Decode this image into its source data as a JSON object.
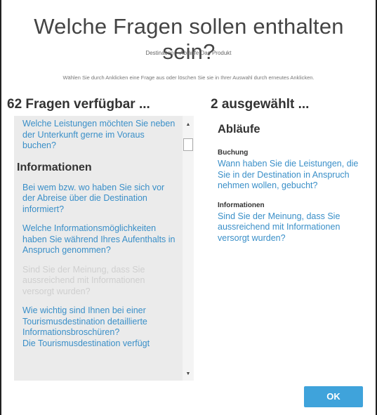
{
  "dialog": {
    "title": "Welche Fragen sollen enthalten sein?",
    "breadcrumb": "Destination > Abläufe Das Produkt",
    "instruction": "Wählen Sie durch Anklicken eine Frage aus oder löschen Sie sie in Ihrer Auswahl durch erneutes Anklicken."
  },
  "available": {
    "header": "62 Fragen verfügbar ...",
    "top_question": "Welche Leistungen möchten Sie neben der Unterkunft gerne im Voraus buchen?",
    "group_heading": "Informationen",
    "questions": [
      {
        "text": "Bei wem bzw. wo haben Sie sich vor der Abreise über die Destination informiert?",
        "selected": false
      },
      {
        "text": "Welche Informationsmöglichkeiten haben Sie während Ihres Aufenthalts in Anspruch genommen?",
        "selected": false
      },
      {
        "text": "Sind Sie der Meinung, dass Sie aussreichend mit Informationen versorgt wurden?",
        "selected": true
      },
      {
        "text": "Wie wichtig sind Ihnen bei einer Tourismusdestination detaillierte Informationsbroschüren?",
        "selected": false
      },
      {
        "text": "Die Tourismusdestination verfügt",
        "selected": false
      }
    ]
  },
  "selected": {
    "header": "2 ausgewählt ...",
    "section_title": "Abläufe",
    "groups": [
      {
        "heading": "Buchung",
        "question": "Wann haben Sie die Leistungen, die Sie in der Destination in Anspruch nehmen wollen, gebucht?"
      },
      {
        "heading": "Informationen",
        "question": "Sind Sie der Meinung, dass Sie aussreichend mit Informationen versorgt wurden?"
      }
    ]
  },
  "scrollbar": {
    "up_icon": "▲",
    "down_icon": "▼"
  },
  "buttons": {
    "ok_label": "OK"
  },
  "colors": {
    "link": "#3a8fc8",
    "disabled": "#cfcfcf",
    "panel": "#ebebeb",
    "button": "#3fa3db"
  }
}
